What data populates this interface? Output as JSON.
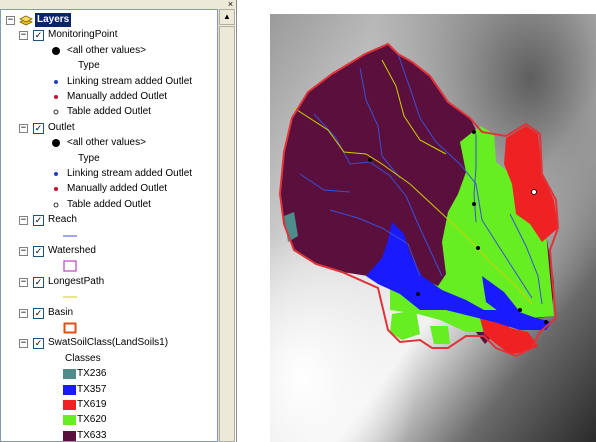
{
  "toc": {
    "close_glyph": "×",
    "root_label": "Layers",
    "layers": [
      {
        "label": "MonitoringPoint",
        "checked": true,
        "items": [
          {
            "symbol": "black-dot",
            "label": "<all other values>"
          },
          {
            "symbol": "none",
            "label": "Type"
          },
          {
            "symbol": "blue-dot",
            "label": "Linking stream added Outlet"
          },
          {
            "symbol": "red-dot",
            "label": "Manually added Outlet"
          },
          {
            "symbol": "white-dot",
            "label": "Table added Outlet"
          }
        ]
      },
      {
        "label": "Outlet",
        "checked": true,
        "items": [
          {
            "symbol": "black-dot",
            "label": "<all other values>"
          },
          {
            "symbol": "none",
            "label": "Type"
          },
          {
            "symbol": "blue-dot",
            "label": "Linking stream added Outlet"
          },
          {
            "symbol": "red-dot",
            "label": "Manually added Outlet"
          },
          {
            "symbol": "white-dot",
            "label": "Table added Outlet"
          }
        ]
      },
      {
        "label": "Reach",
        "checked": true,
        "items": [
          {
            "symbol": "blue-line",
            "label": ""
          }
        ]
      },
      {
        "label": "Watershed",
        "checked": true,
        "items": [
          {
            "symbol": "magenta-box",
            "label": ""
          }
        ]
      },
      {
        "label": "LongestPath",
        "checked": true,
        "items": [
          {
            "symbol": "yellow-line",
            "label": ""
          }
        ]
      },
      {
        "label": "Basin",
        "checked": true,
        "items": [
          {
            "symbol": "orange-box",
            "label": ""
          }
        ]
      },
      {
        "label": "SwatSoilClass(LandSoils1)",
        "checked": true,
        "items": [
          {
            "symbol": "none",
            "label": "Classes"
          },
          {
            "symbol": "swatch",
            "color": "#4f8c8c",
            "label": "TX236"
          },
          {
            "symbol": "swatch",
            "color": "#1a1aff",
            "label": "TX357"
          },
          {
            "symbol": "swatch",
            "color": "#ee2222",
            "label": "TX619"
          },
          {
            "symbol": "swatch",
            "color": "#66ee22",
            "label": "TX620"
          },
          {
            "symbol": "swatch",
            "color": "#5a0f3c",
            "label": "TX633"
          }
        ]
      }
    ]
  },
  "colors": {
    "TX236": "#4f8c8c",
    "TX357": "#1a1aff",
    "TX619": "#ee2222",
    "TX620": "#66ee22",
    "TX633": "#5a0f3c",
    "basin_outline": "#e0333a",
    "reach": "#3b4fd8",
    "longest_path": "#cfcf00",
    "watershed": "#c040c0"
  }
}
